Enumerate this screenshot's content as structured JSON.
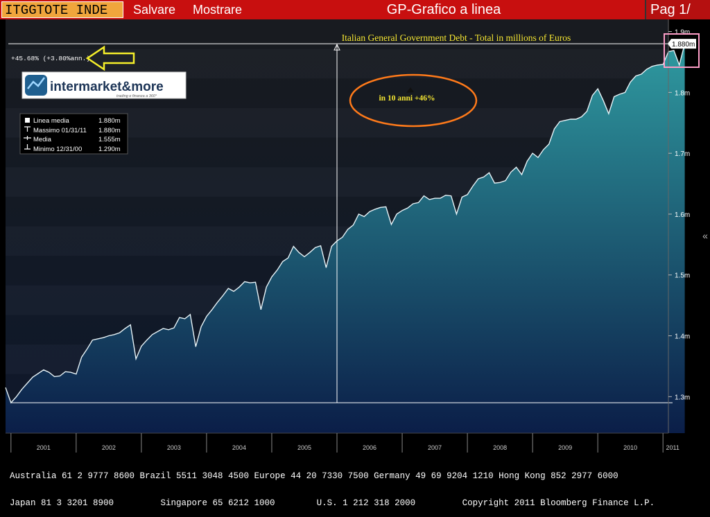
{
  "header": {
    "ticker": "ITGGTOTE INDE",
    "menu": [
      "Salvare",
      "Mostrare"
    ],
    "title": "GP-Grafico a linea",
    "page": "Pag 1/"
  },
  "colors": {
    "topbar": "#c80f0f",
    "ticker_bg": "#f0a53c",
    "title_text": "#f5e632",
    "arrow": "#f5ef2a",
    "ellipse": "#ff7a1a",
    "last_value_box": "#ff9ec8"
  },
  "annotations": {
    "change": "+45.68% (+3.80%ann.)",
    "ellipse_text": "in 10 anni +46%",
    "logo_text": "intermarket&more",
    "logo_tagline": "trading e finanza a 360°"
  },
  "legend": [
    {
      "icon": "square",
      "label": "Linea media",
      "value": "1.880m"
    },
    {
      "icon": "max",
      "label": "Massimo 01/31/11",
      "value": "1.880m"
    },
    {
      "icon": "avg",
      "label": "Media",
      "value": "1.555m"
    },
    {
      "icon": "min",
      "label": "Minimo 12/31/00",
      "value": "1.290m"
    }
  ],
  "footer": {
    "line1": "Australia 61 2 9777 8600 Brazil 5511 3048 4500 Europe 44 20 7330 7500 Germany 49 69 9204 1210 Hong Kong 852 2977 6000",
    "line2": "Japan 81 3 3201 8900         Singapore 65 6212 1000        U.S. 1 212 318 2000         Copyright 2011 Bloomberg Finance L.P."
  },
  "chart_data": {
    "type": "area",
    "title": "Italian General Government Debt - Total in millions of Euros",
    "xlabel": "",
    "ylabel": "",
    "x_range": [
      2000.917,
      2011.083
    ],
    "ylim": [
      1.24,
      1.92
    ],
    "y_ticks": [
      1.3,
      1.4,
      1.5,
      1.6,
      1.7,
      1.8,
      1.9
    ],
    "y_tick_labels": [
      "1.3m",
      "1.4m",
      "1.5m",
      "1.6m",
      "1.7m",
      "1.8m",
      "1.9m"
    ],
    "year_labels": [
      "2001",
      "2002",
      "2003",
      "2004",
      "2005",
      "2006",
      "2007",
      "2008",
      "2009",
      "2010",
      "2011"
    ],
    "last_value_label": "1.880m",
    "max_reference": 1.88,
    "min_reference": 1.29,
    "grid": false,
    "legend_position": "top-left",
    "series": [
      {
        "values": [
          1.315,
          1.29,
          1.3,
          1.312,
          1.322,
          1.332,
          1.338,
          1.344,
          1.34,
          1.333,
          1.334,
          1.341,
          1.34,
          1.337,
          1.365,
          1.378,
          1.393,
          1.395,
          1.397,
          1.4,
          1.402,
          1.405,
          1.412,
          1.418,
          1.362,
          1.383,
          1.393,
          1.402,
          1.407,
          1.412,
          1.41,
          1.413,
          1.43,
          1.428,
          1.435,
          1.382,
          1.415,
          1.432,
          1.443,
          1.455,
          1.466,
          1.478,
          1.473,
          1.48,
          1.489,
          1.487,
          1.488,
          1.443,
          1.48,
          1.497,
          1.508,
          1.522,
          1.528,
          1.547,
          1.537,
          1.53,
          1.537,
          1.545,
          1.548,
          1.512,
          1.547,
          1.556,
          1.562,
          1.575,
          1.582,
          1.6,
          1.596,
          1.604,
          1.608,
          1.611,
          1.612,
          1.583,
          1.6,
          1.606,
          1.61,
          1.617,
          1.619,
          1.63,
          1.624,
          1.626,
          1.626,
          1.631,
          1.63,
          1.6,
          1.628,
          1.632,
          1.646,
          1.658,
          1.661,
          1.668,
          1.651,
          1.652,
          1.655,
          1.669,
          1.677,
          1.665,
          1.687,
          1.7,
          1.693,
          1.706,
          1.715,
          1.74,
          1.752,
          1.754,
          1.756,
          1.756,
          1.76,
          1.769,
          1.795,
          1.806,
          1.787,
          1.765,
          1.793,
          1.797,
          1.8,
          1.817,
          1.827,
          1.83,
          1.838,
          1.843,
          1.845,
          1.846,
          1.867,
          1.869,
          1.845,
          1.88
        ]
      }
    ]
  }
}
